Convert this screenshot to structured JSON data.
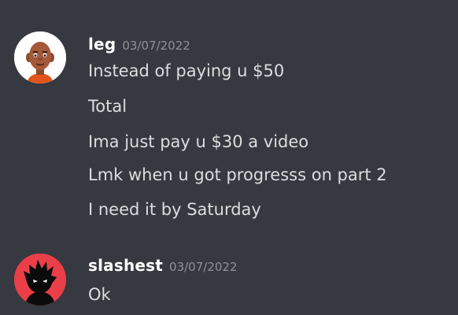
{
  "messages": [
    {
      "username": "leg",
      "timestamp": "03/07/2022",
      "avatar_icon": "mii-face-avatar",
      "lines": [
        "Instead of paying u $50",
        "Total",
        "Ima just pay u $30 a video",
        "Lmk when u got progresss on part 2",
        "I need it by Saturday"
      ]
    },
    {
      "username": "slashest",
      "timestamp": "03/07/2022",
      "avatar_icon": "spiky-shadow-avatar",
      "lines": [
        "Ok"
      ]
    }
  ],
  "colors": {
    "background": "#36393f",
    "username": "#ffffff",
    "timestamp": "#8e9297",
    "message_text": "#dcddde",
    "avatar2_bg": "#ea3e49"
  }
}
